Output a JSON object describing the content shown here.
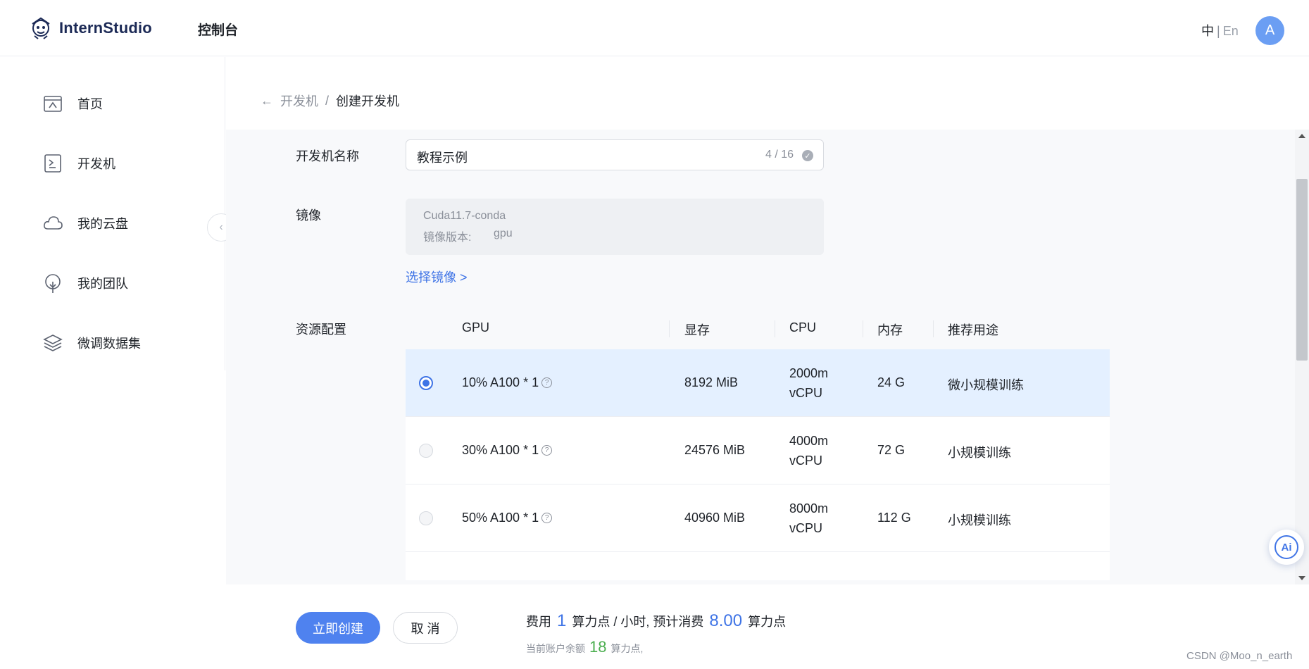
{
  "header": {
    "logo_text": "InternStudio",
    "console_title": "控制台",
    "lang_zh": "中",
    "lang_sep": "|",
    "lang_en": "En",
    "avatar_initial": "A"
  },
  "sidebar": {
    "items": [
      {
        "label": "首页",
        "icon": "home-icon"
      },
      {
        "label": "开发机",
        "icon": "terminal-icon"
      },
      {
        "label": "我的云盘",
        "icon": "cloud-icon"
      },
      {
        "label": "我的团队",
        "icon": "team-icon"
      },
      {
        "label": "微调数据集",
        "icon": "layers-icon"
      }
    ],
    "collapse_glyph": "‹"
  },
  "breadcrumb": {
    "back_glyph": "←",
    "parent": "开发机",
    "separator": "/",
    "current": "创建开发机"
  },
  "form": {
    "name_label": "开发机名称",
    "name_value": "教程示例",
    "name_count": "4 / 16",
    "image_label": "镜像",
    "image_name": "Cuda11.7-conda",
    "image_version_label": "镜像版本:",
    "image_version_value": "gpu",
    "select_image_link": "选择镜像 >",
    "resource_label": "资源配置"
  },
  "resource_table": {
    "headers": [
      "GPU",
      "显存",
      "CPU",
      "内存",
      "推荐用途"
    ],
    "rows": [
      {
        "gpu": "10% A100 * 1",
        "vram": "8192 MiB",
        "cpu_line1": "2000m",
        "cpu_line2": "vCPU",
        "mem": "24 G",
        "usage": "微小规模训练",
        "selected": true
      },
      {
        "gpu": "30% A100 * 1",
        "vram": "24576 MiB",
        "cpu_line1": "4000m",
        "cpu_line2": "vCPU",
        "mem": "72 G",
        "usage": "小规模训练",
        "selected": false
      },
      {
        "gpu": "50% A100 * 1",
        "vram": "40960 MiB",
        "cpu_line1": "8000m",
        "cpu_line2": "vCPU",
        "mem": "112 G",
        "usage": "小规模训练",
        "selected": false
      }
    ],
    "help_glyph": "?"
  },
  "ai_button": {
    "label": "Ai"
  },
  "footer": {
    "create_label": "立即创建",
    "cancel_label": "取 消",
    "cost_prefix": "费用",
    "cost_rate": "1",
    "cost_rate_unit": "算力点 / 小时, 预计消费",
    "cost_total": "8.00",
    "cost_total_unit": "算力点",
    "balance_prefix": "当前账户余额",
    "balance_value": "18",
    "balance_unit": "算力点,",
    "watermark": "CSDN @Moo_n_earth"
  },
  "colors": {
    "accent": "#3f74e6",
    "primary_button": "#4f82ef",
    "selected_row": "#e4f0ff",
    "balance_green": "#4caf50",
    "avatar": "#6b9ef3"
  }
}
